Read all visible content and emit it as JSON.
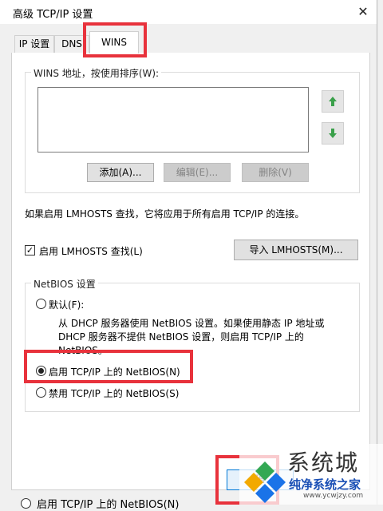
{
  "window": {
    "title": "高级 TCP/IP 设置",
    "close_glyph": "✕"
  },
  "tabs": [
    {
      "label": "IP 设置"
    },
    {
      "label": "DNS"
    },
    {
      "label": "WINS"
    }
  ],
  "wins": {
    "group_label": "WINS 地址，按使用排序(W):",
    "add_label": "添加(A)...",
    "edit_label": "编辑(E)...",
    "remove_label": "删除(V)",
    "up_icon": "arrow-up-icon",
    "down_icon": "arrow-down-icon"
  },
  "lmhosts": {
    "info": "如果启用 LMHOSTS 查找，它将应用于所有启用 TCP/IP 的连接。",
    "checkbox_label": "启用 LMHOSTS 查找(L)",
    "checked": true,
    "import_label": "导入 LMHOSTS(M)..."
  },
  "netbios": {
    "group_label": "NetBIOS 设置",
    "default_label": "默认(F):",
    "default_desc_1": "从 DHCP 服务器使用 NetBIOS 设置。如果使用静态 IP 地址或",
    "default_desc_2": "DHCP 服务器不提供 NetBIOS 设置，则启用 TCP/IP 上的",
    "default_desc_3": "NetBIOS。",
    "enable_label": "启用 TCP/IP 上的 NetBIOS(N)",
    "disable_label": "禁用 TCP/IP 上的 NetBIOS(S)",
    "selected": "enable"
  },
  "footer": {
    "ok_label": "确",
    "behind_text": "启用 TCP/IP 上的 NetBIOS(N)"
  },
  "watermark": {
    "brand": "系统城",
    "site_name": "纯净系统之家",
    "site_url": "www.ycwjzy.com"
  },
  "colors": {
    "highlight": "#e8323c",
    "arrow_green": "#3aa04a"
  }
}
